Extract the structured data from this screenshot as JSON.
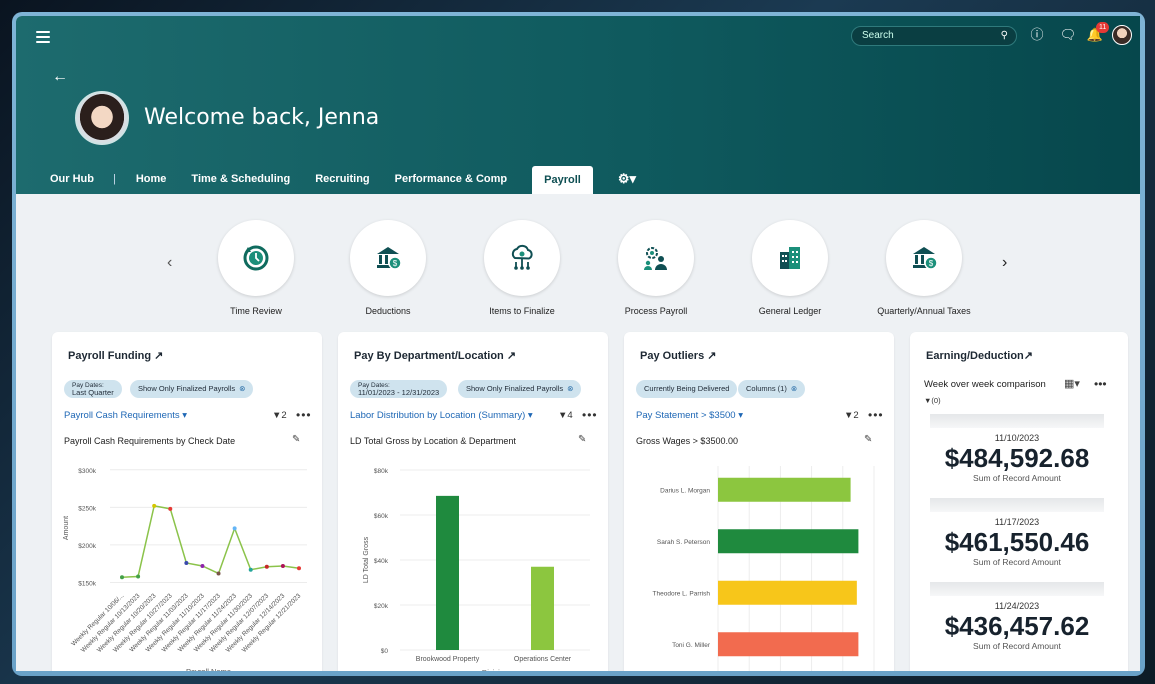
{
  "header": {
    "search_placeholder": "Search",
    "notification_count": "11",
    "welcome": "Welcome back, Jenna"
  },
  "nav": {
    "items": [
      "Our Hub",
      "Home",
      "Time & Scheduling",
      "Recruiting",
      "Performance & Comp",
      "Payroll"
    ],
    "separator": "|",
    "active": "Payroll"
  },
  "quick_actions": [
    {
      "label": "Time Review",
      "icon": "clock-refresh-icon"
    },
    {
      "label": "Deductions",
      "icon": "bank-dollar-icon"
    },
    {
      "label": "Items to Finalize",
      "icon": "cloud-network-icon"
    },
    {
      "label": "Process Payroll",
      "icon": "gear-people-icon"
    },
    {
      "label": "General Ledger",
      "icon": "building-icon"
    },
    {
      "label": "Quarterly/Annual Taxes",
      "icon": "bank-dollar-icon"
    }
  ],
  "cards": {
    "funding": {
      "title": "Payroll Funding ↗",
      "chip1_top": "Pay Dates:",
      "chip1_bottom": "Last Quarter",
      "chip2": "Show Only Finalized Payrolls",
      "link": "Payroll Cash Requirements ▾",
      "filter": "▼2",
      "more": "•••",
      "chart_title": "Payroll Cash Requirements by Check Date"
    },
    "dept": {
      "title": "Pay By Department/Location ↗",
      "chip1_top": "Pay Dates:",
      "chip1_bottom": "11/01/2023 - 12/31/2023",
      "chip2": "Show Only Finalized Payrolls",
      "link": "Labor Distribution by Location (Summary) ▾",
      "filter": "▼4",
      "more": "•••",
      "chart_title": "LD Total Gross by Location & Department"
    },
    "outliers": {
      "title": "Pay Outliers ↗",
      "chip1": "Currently Being Delivered",
      "chip2": "Columns (1)",
      "link": "Pay Statement > $3500 ▾",
      "filter": "▼2",
      "more": "•••",
      "chart_title": "Gross Wages > $3500.00"
    },
    "earning": {
      "title": "Earning/Deduction↗",
      "subtitle": "Week over week comparison",
      "filter": "▼(0)",
      "more": "•••",
      "entries": [
        {
          "date": "11/10/2023",
          "amount": "$484,592.68",
          "label": "Sum of Record Amount"
        },
        {
          "date": "11/17/2023",
          "amount": "$461,550.46",
          "label": "Sum of Record Amount"
        },
        {
          "date": "11/24/2023",
          "amount": "$436,457.62",
          "label": "Sum of Record Amount"
        }
      ]
    }
  },
  "chart_data": [
    {
      "type": "line",
      "title": "Payroll Cash Requirements by Check Date",
      "xlabel": "Payroll Name",
      "ylabel": "Amount",
      "yticks": [
        "$300k",
        "$250k",
        "$200k",
        "$150k"
      ],
      "ylim": [
        140000,
        305000
      ],
      "categories": [
        "Weekly Regular 10/06/...",
        "Weekly Regular 10/13/2023",
        "Weekly Regular 10/20/2023",
        "Weekly Regular 10/27/2023",
        "Weekly Regular 11/03/2023",
        "Weekly Regular 11/10/2023",
        "Weekly Regular 11/17/2023",
        "Weekly Regular 11/24/2023",
        "Weekly Regular 11/30/2023",
        "Weekly Regular 12/07/2023",
        "Weekly Regular 12/14/2023",
        "Weekly Regular 12/21/2023"
      ],
      "values": [
        157000,
        158000,
        252000,
        248000,
        176000,
        172000,
        162000,
        222000,
        167000,
        171000,
        172000,
        169000
      ],
      "point_colors": [
        "#43a047",
        "#43a047",
        "#d4c700",
        "#e53935",
        "#3949ab",
        "#8e24aa",
        "#795548",
        "#64b5f6",
        "#26a69a",
        "#c62828",
        "#ad1457",
        "#e53935"
      ],
      "line_color": "#8bc34a"
    },
    {
      "type": "bar",
      "title": "LD Total Gross by Location & Department",
      "xlabel": "Division",
      "ylabel": "LD Total Gross",
      "yticks": [
        "$80k",
        "$60k",
        "$40k",
        "$20k",
        "$0"
      ],
      "ylim": [
        0,
        80000
      ],
      "categories": [
        "Brookwood Property",
        "Operations Center"
      ],
      "values": [
        68500,
        37000
      ],
      "colors": [
        "#1f8a3e",
        "#8cc63f"
      ]
    },
    {
      "type": "bar",
      "orientation": "horizontal",
      "title": "Gross Wages > $3500.00",
      "categories": [
        "Darius L. Morgan",
        "Sarah S. Peterson",
        "Theodore L. Parrish",
        "Toni G. Miller"
      ],
      "values": [
        4.25,
        4.5,
        4.45,
        4.5
      ],
      "xlim": [
        0,
        5
      ],
      "colors": [
        "#8cc63f",
        "#1f8a3e",
        "#f7c61a",
        "#f26b4f"
      ]
    }
  ]
}
